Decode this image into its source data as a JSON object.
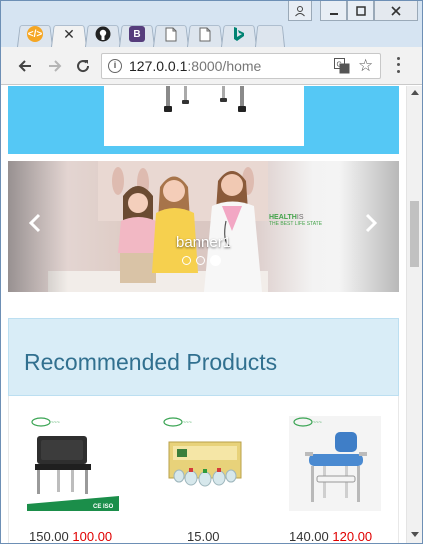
{
  "browser": {
    "tabs": [
      {
        "name": "tab-1",
        "icon": "code-icon",
        "color": "#f5a623"
      },
      {
        "name": "tab-2",
        "icon": "close-icon",
        "active": true
      },
      {
        "name": "tab-3",
        "icon": "github-icon"
      },
      {
        "name": "tab-4",
        "icon": "bootstrap-icon",
        "color": "#563d7c"
      },
      {
        "name": "tab-5",
        "icon": "document-icon"
      },
      {
        "name": "tab-6",
        "icon": "document-icon"
      },
      {
        "name": "tab-7",
        "icon": "bing-icon",
        "color": "#008373"
      }
    ],
    "url_host": "127.0.0.1",
    "url_path": ":8000/home"
  },
  "carousel": {
    "caption": "banner1",
    "prev_icon": "chevron-left-icon",
    "next_icon": "chevron-right-icon",
    "slide_count": 3,
    "active_slide": 3,
    "brand_text": "HEALTH",
    "brand_suffix": "IS",
    "brand_tagline": "THE BEST LIFE STATE"
  },
  "section": {
    "title": "Recommended Products"
  },
  "products": [
    {
      "name": "commode-chair",
      "original_price": "150.00",
      "sale_price": "100.00"
    },
    {
      "name": "cupping-set",
      "original_price": "15.00",
      "sale_price": ""
    },
    {
      "name": "shower-chair",
      "original_price": "140.00",
      "sale_price": "120.00"
    }
  ],
  "colors": {
    "banner_blue": "#55c8f5",
    "heading_bg": "#d9edf7",
    "heading_text": "#31708f",
    "sale_red": "#e00000"
  }
}
